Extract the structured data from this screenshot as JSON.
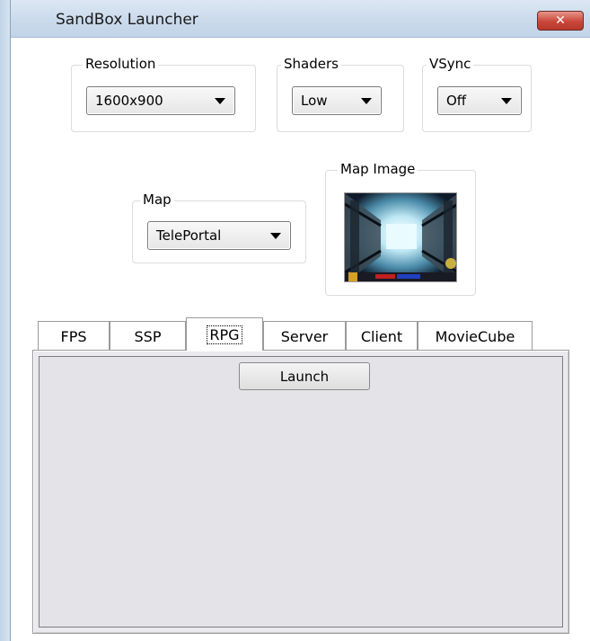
{
  "window": {
    "title": "SandBox Launcher",
    "close_glyph": "✕"
  },
  "resolution": {
    "label": "Resolution",
    "value": "1600x900"
  },
  "shaders": {
    "label": "Shaders",
    "value": "Low"
  },
  "vsync": {
    "label": "VSync",
    "value": "Off"
  },
  "map": {
    "label": "Map",
    "value": "TelePortal"
  },
  "map_image": {
    "label": "Map Image",
    "icon": "teleportal-corridor-thumbnail"
  },
  "tabs": [
    {
      "label": "FPS",
      "active": false
    },
    {
      "label": "SSP",
      "active": false
    },
    {
      "label": "RPG",
      "active": true
    },
    {
      "label": "Server",
      "active": false
    },
    {
      "label": "Client",
      "active": false
    },
    {
      "label": "MovieCube",
      "active": false
    }
  ],
  "launch": {
    "label": "Launch"
  },
  "colors": {
    "titlebar": "#c9d9eb",
    "close": "#c9473a",
    "panel": "#e3e3e8"
  }
}
